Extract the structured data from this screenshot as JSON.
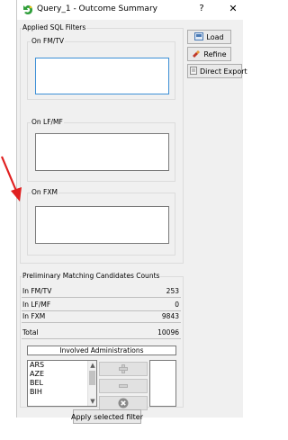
{
  "window": {
    "title": "Query_1 - Outcome Summary",
    "help_label": "?",
    "close_label": "✕"
  },
  "filters": {
    "group_label": "Applied SQL Filters",
    "fm_label": "On FM/TV",
    "lf_label": "On LF/MF",
    "fxm_label": "On FXM"
  },
  "actions": {
    "load": "Load",
    "refine": "Refine",
    "export": "Direct Export"
  },
  "counts": {
    "group_label": "Preliminary Matching Candidates Counts",
    "rows": [
      {
        "label": "In FM/TV",
        "value": "253"
      },
      {
        "label": "In LF/MF",
        "value": "0"
      },
      {
        "label": "In FXM",
        "value": "9843"
      }
    ],
    "total_label": "Total",
    "total_value": "10096"
  },
  "admin": {
    "header": "Involved Administrations",
    "items": [
      "ARS",
      "AZE",
      "BEL",
      "BIH"
    ],
    "apply_label": "Apply selected filter"
  },
  "colors": {
    "accent": "#3c8fd6",
    "arrow": "#e02020",
    "remove_btn": "#8a8a8a"
  }
}
